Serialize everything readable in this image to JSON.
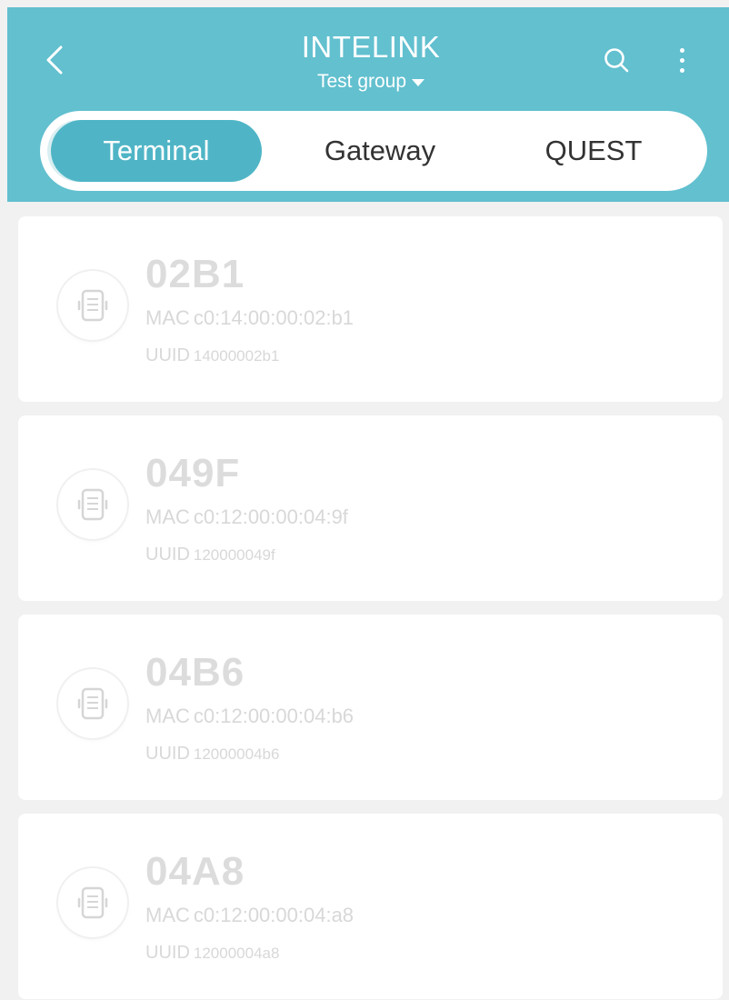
{
  "header": {
    "title": "INTELINK",
    "group_label": "Test group",
    "background_color": "#62c0cf",
    "icons": {
      "back": "chevron-left-icon",
      "search": "search-icon",
      "more": "more-vertical-icon",
      "group_dropdown": "caret-down-icon"
    }
  },
  "tabs": [
    {
      "label": "Terminal",
      "active": true
    },
    {
      "label": "Gateway",
      "active": false
    },
    {
      "label": "QUEST",
      "active": false
    }
  ],
  "devices": [
    {
      "name": "02B1",
      "mac_label": "MAC",
      "mac": "c0:14:00:00:02:b1",
      "uuid_label": "UUID",
      "uuid": "14000002b1"
    },
    {
      "name": "049F",
      "mac_label": "MAC",
      "mac": "c0:12:00:00:04:9f",
      "uuid_label": "UUID",
      "uuid": "120000049f"
    },
    {
      "name": "04B6",
      "mac_label": "MAC",
      "mac": "c0:12:00:00:04:b6",
      "uuid_label": "UUID",
      "uuid": "12000004b6"
    },
    {
      "name": "04A8",
      "mac_label": "MAC",
      "mac": "c0:12:00:00:04:a8",
      "uuid_label": "UUID",
      "uuid": "12000004a8"
    }
  ],
  "device_icon": "terminal-device-icon",
  "accent_color": "#4fb5c6"
}
